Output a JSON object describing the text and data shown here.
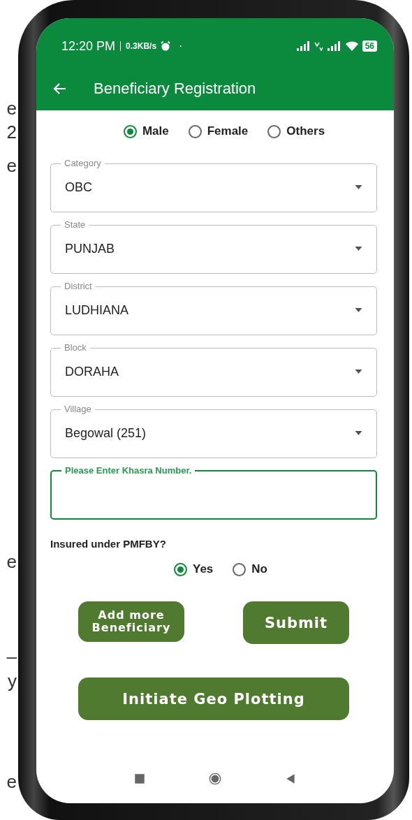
{
  "page_behind": {
    "fragments": [
      "e",
      "2",
      "e",
      "e",
      "–",
      "y",
      "e"
    ]
  },
  "status_bar": {
    "time": "12:20 PM",
    "speed": "0.3KB/s",
    "dot": "·",
    "battery": "56"
  },
  "toolbar": {
    "title": "Beneficiary Registration"
  },
  "gender": {
    "options": [
      {
        "label": "Male",
        "selected": true
      },
      {
        "label": "Female",
        "selected": false
      },
      {
        "label": "Others",
        "selected": false
      }
    ]
  },
  "fields": [
    {
      "kind": "select",
      "label": "Category",
      "value": "OBC",
      "focused": false
    },
    {
      "kind": "select",
      "label": "State",
      "value": "PUNJAB",
      "focused": false
    },
    {
      "kind": "select",
      "label": "District",
      "value": "LUDHIANA",
      "focused": false
    },
    {
      "kind": "select",
      "label": "Block",
      "value": "DORAHA",
      "focused": false
    },
    {
      "kind": "select",
      "label": "Village",
      "value": "Begowal (251)",
      "focused": false
    },
    {
      "kind": "text",
      "label": "Please Enter Khasra Number.",
      "focused": true
    }
  ],
  "insurance": {
    "question": "Insured under PMFBY?",
    "options": [
      {
        "label": "Yes",
        "selected": true
      },
      {
        "label": "No",
        "selected": false
      }
    ]
  },
  "buttons": {
    "add_more": "Add more Beneficiary",
    "submit": "Submit",
    "geo": "Initiate Geo Plotting"
  }
}
